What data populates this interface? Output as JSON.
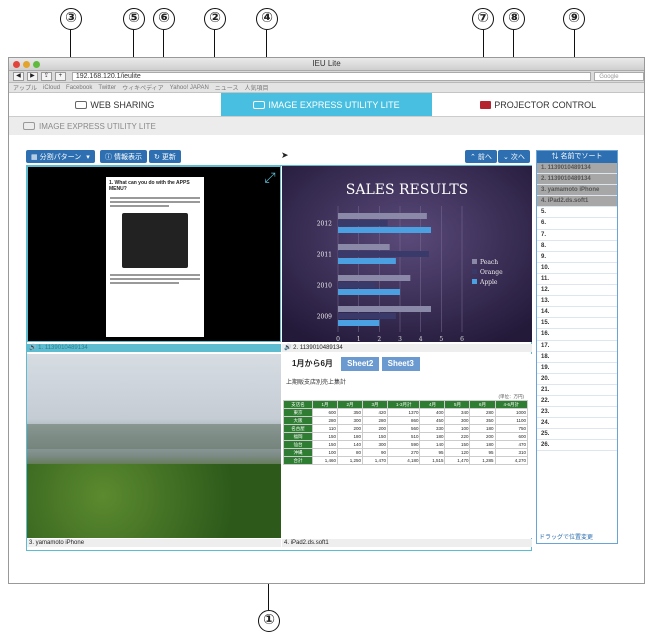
{
  "callouts": [
    "③",
    "⑤",
    "⑥",
    "②",
    "④",
    "⑦",
    "⑧",
    "⑨",
    "①"
  ],
  "window": {
    "title": "IEU Lite"
  },
  "browser": {
    "url": "192.168.120.1/ieulite",
    "search_placeholder": "Google",
    "bookmarks": [
      "アップル",
      "iCloud",
      "Facebook",
      "Twitter",
      "ウィキペディア",
      "Yahoo! JAPAN",
      "ニュース",
      "人気項目"
    ]
  },
  "tabs": [
    {
      "label": "WEB SHARING"
    },
    {
      "label": "IMAGE EXPRESS UTILITY LITE"
    },
    {
      "label": "PROJECTOR CONTROL"
    }
  ],
  "subheader": "IMAGE EXPRESS UTILITY LITE",
  "toolbar": {
    "split_label": "分割パターン",
    "info_label": "情報表示",
    "refresh_label": "更新",
    "prev_label": "前へ",
    "next_label": "次へ"
  },
  "panes": [
    {
      "caption": "1. 1139010489134",
      "doc_title": "1. What can you do with the APPS MENU?"
    },
    {
      "caption": "2. 1139010489134"
    },
    {
      "caption": "3. yamamoto iPhone"
    },
    {
      "caption": "4. iPad2.ds.soft1"
    }
  ],
  "sidebar": {
    "header": "名前でソート",
    "items": [
      "1. 1139010489134",
      "2. 1139010489134",
      "3. yamamoto iPhone",
      "4. iPad2.ds.soft1",
      "5.",
      "6.",
      "7.",
      "8.",
      "9.",
      "10.",
      "11.",
      "12.",
      "13.",
      "14.",
      "15.",
      "16.",
      "17.",
      "18.",
      "19.",
      "20.",
      "21.",
      "22.",
      "23.",
      "24.",
      "25.",
      "26."
    ],
    "footer": "ドラッグで位置変更"
  },
  "chart_data": {
    "type": "bar",
    "title": "SALES RESULTS",
    "categories": [
      "2012",
      "2011",
      "2010",
      "2009"
    ],
    "series": [
      {
        "name": "Peach",
        "values": [
          4.3,
          2.5,
          3.5,
          4.5
        ]
      },
      {
        "name": "Orange",
        "values": [
          2.4,
          4.4,
          1.8,
          2.8
        ]
      },
      {
        "name": "Apple",
        "values": [
          4.5,
          2.8,
          3.0,
          2.0
        ]
      }
    ],
    "xlim": [
      0,
      6
    ],
    "xticks": [
      "0",
      "1",
      "2",
      "3",
      "4",
      "5",
      "6"
    ],
    "colors": {
      "Peach": "#8a8aa8",
      "Orange": "#3a3a6a",
      "Apple": "#4aa0e0"
    }
  },
  "spreadsheet": {
    "tabs": [
      "1月から6月",
      "Sheet2",
      "Sheet3"
    ],
    "title": "上期販支店別売上集計",
    "unit": "(単位：万円)",
    "headers": [
      "支店名",
      "1月",
      "2月",
      "3月",
      "1-3月計",
      "4月",
      "5月",
      "6月",
      "4-6月計"
    ],
    "rows": [
      [
        "東京",
        "600",
        "350",
        "420",
        "1370",
        "400",
        "340",
        "280",
        "1000"
      ],
      [
        "大阪",
        "280",
        "300",
        "280",
        "860",
        "450",
        "300",
        "350",
        "1100"
      ],
      [
        "名古屋",
        "110",
        "200",
        "200",
        "560",
        "330",
        "100",
        "180",
        "750"
      ],
      [
        "福岡",
        "150",
        "180",
        "150",
        "510",
        "180",
        "220",
        "200",
        "600"
      ],
      [
        "仙台",
        "150",
        "140",
        "300",
        "590",
        "140",
        "150",
        "180",
        "470"
      ],
      [
        "沖縄",
        "100",
        "80",
        "90",
        "270",
        "95",
        "120",
        "95",
        "310"
      ],
      [
        "合計",
        "1,460",
        "1,250",
        "1,470",
        "4,180",
        "1,515",
        "1,470",
        "1,285",
        "4,270"
      ]
    ]
  }
}
